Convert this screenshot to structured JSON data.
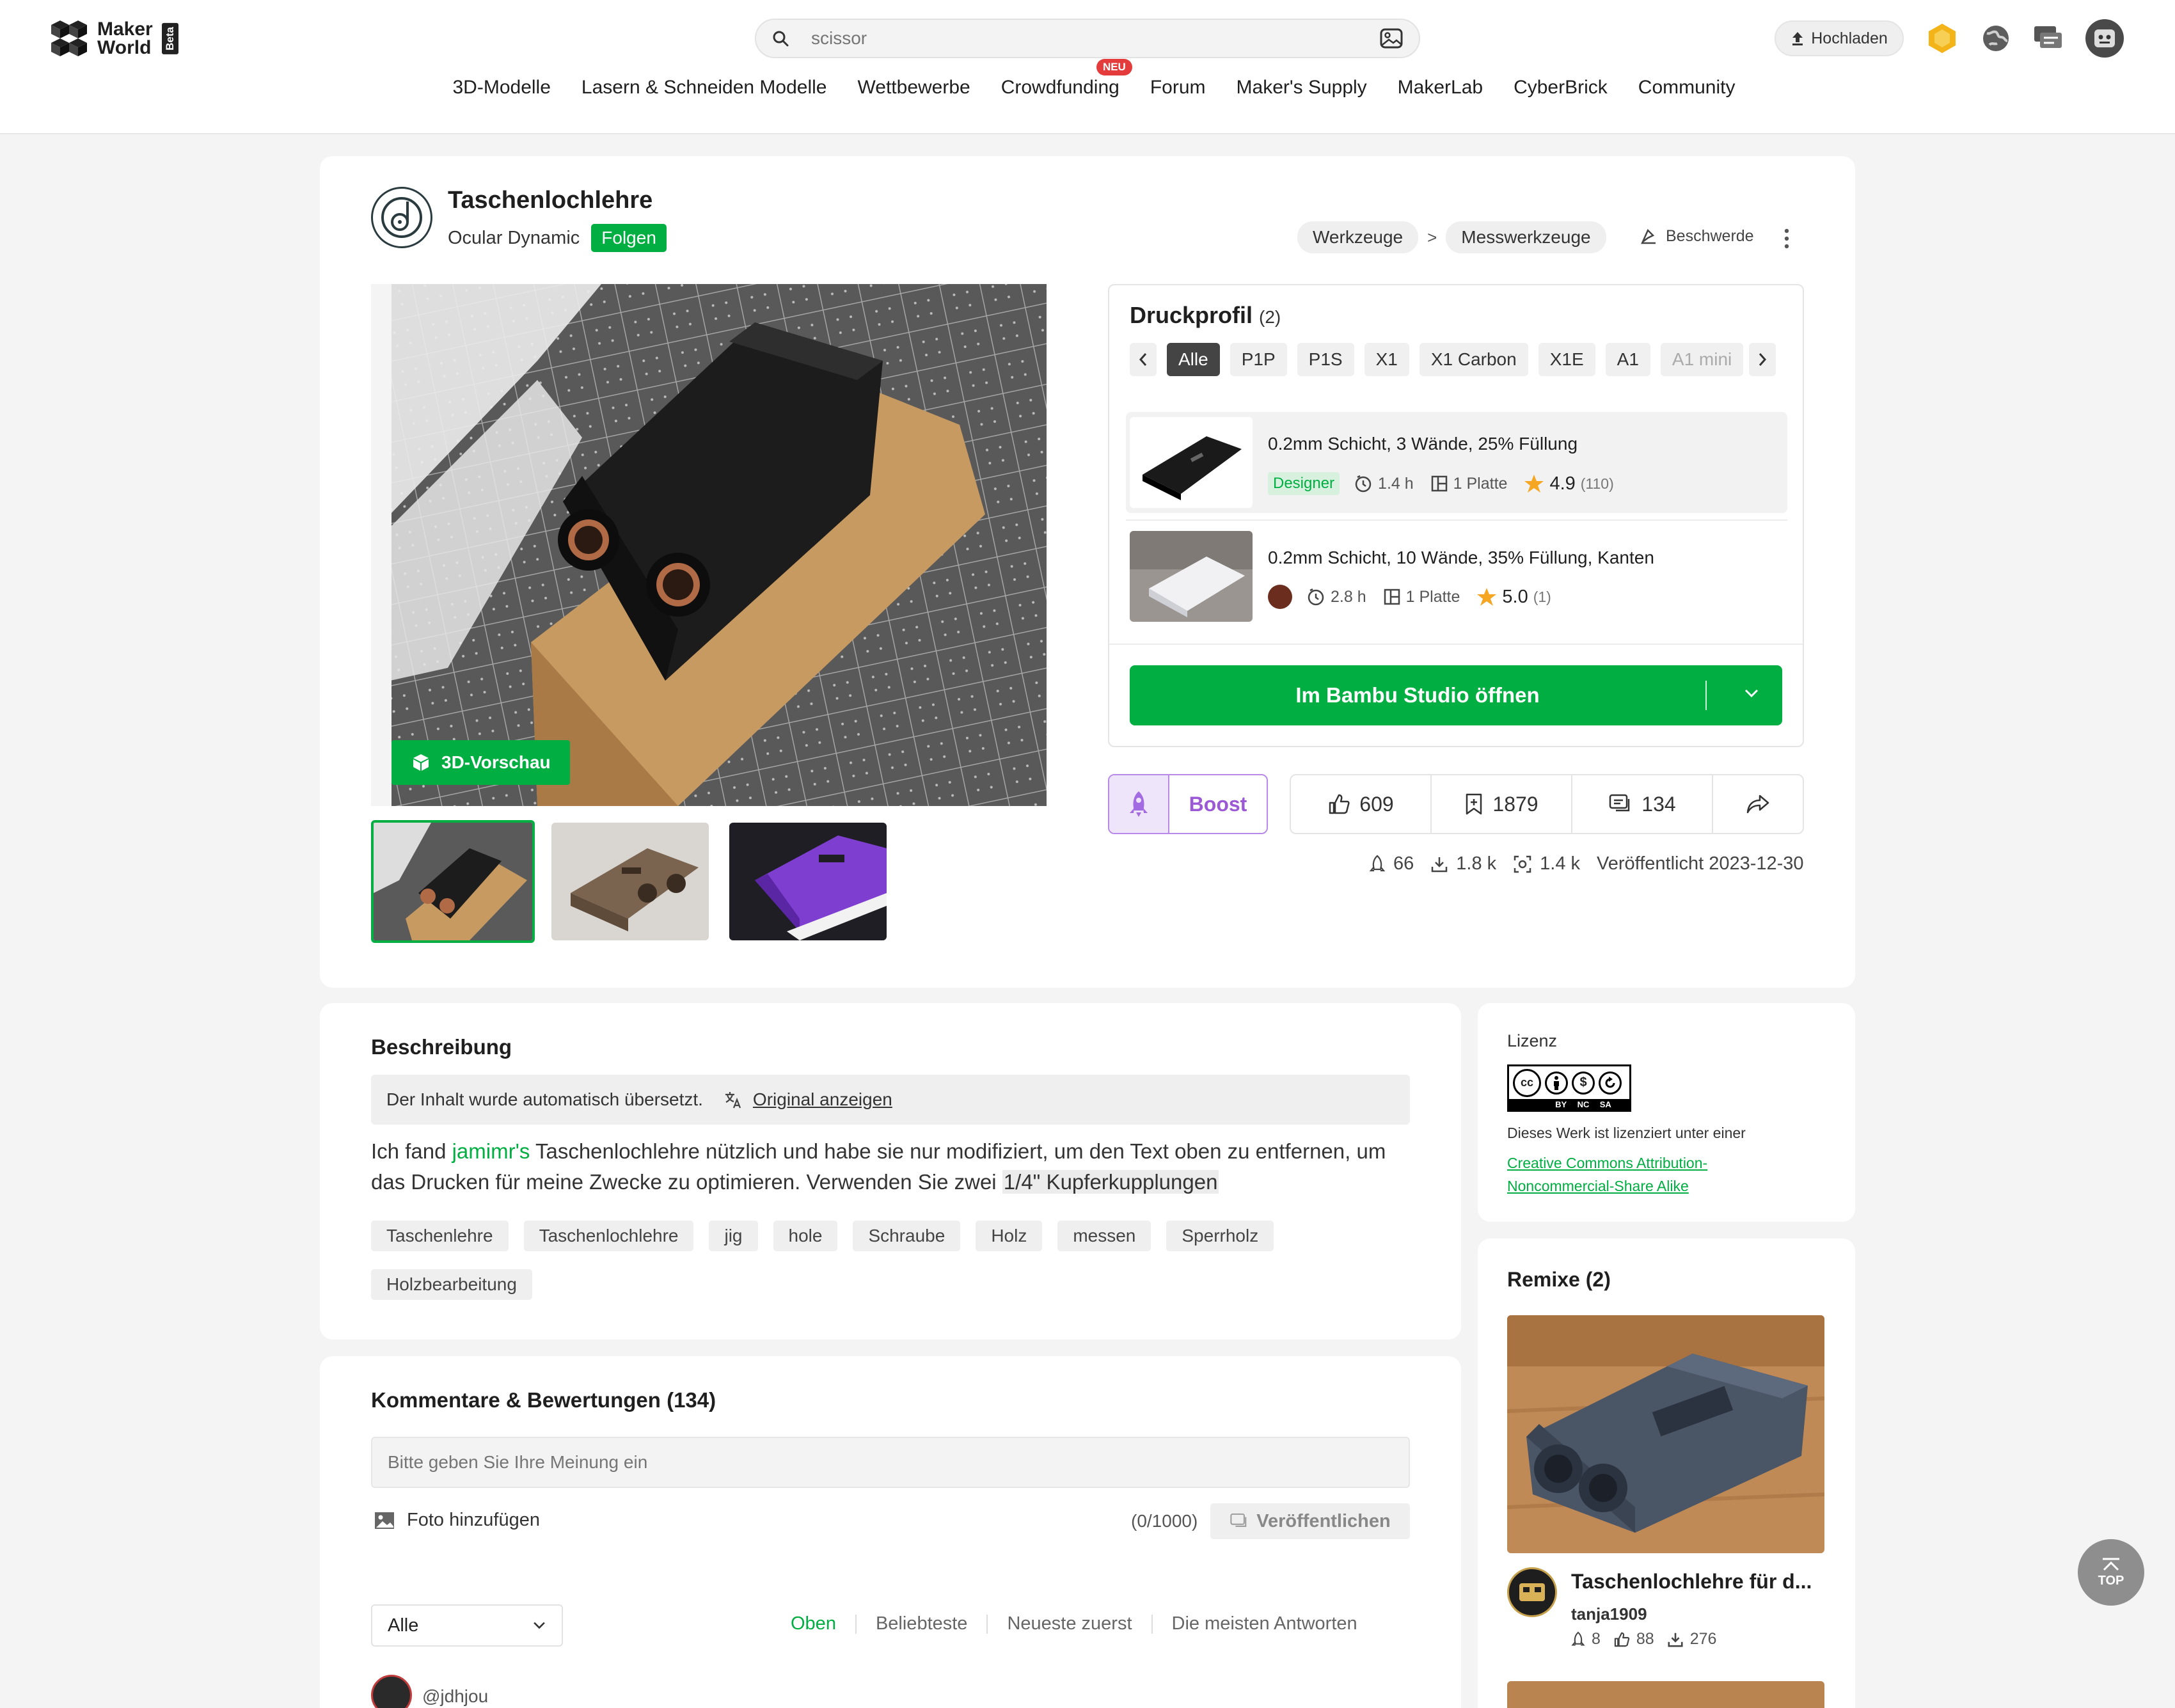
{
  "header": {
    "logo_line1": "Maker",
    "logo_line2": "World",
    "logo_badge": "Beta",
    "search_placeholder": "scissor",
    "upload_label": "Hochladen",
    "nav": [
      "3D-Modelle",
      "Lasern & Schneiden Modelle",
      "Wettbewerbe",
      "Crowdfunding",
      "Forum",
      "Maker's Supply",
      "MakerLab",
      "CyberBrick",
      "Community"
    ],
    "new_badge": "NEU"
  },
  "model": {
    "title": "Taschenlochlehre",
    "author": "Ocular Dynamic",
    "follow_label": "Folgen",
    "breadcrumb": [
      "Werkzeuge",
      "Messwerkzeuge"
    ],
    "breadcrumb_sep": ">",
    "report_label": "Beschwerde",
    "preview_label": "3D-Vorschau"
  },
  "print_profile": {
    "heading": "Druckprofil",
    "count": "(2)",
    "tabs": [
      "Alle",
      "P1P",
      "P1S",
      "X1",
      "X1 Carbon",
      "X1E",
      "A1",
      "A1 mini"
    ],
    "profiles": [
      {
        "name": "0.2mm Schicht, 3 Wände, 25% Füllung",
        "badge": "Designer",
        "time": "1.4 h",
        "plates": "1 Platte",
        "rating": "4.9",
        "rating_count": "(110)"
      },
      {
        "name": "0.2mm Schicht, 10 Wände, 35% Füllung, Kanten",
        "time": "2.8 h",
        "plates": "1 Platte",
        "rating": "5.0",
        "rating_count": "(1)"
      }
    ],
    "open_button": "Im Bambu Studio öffnen"
  },
  "actions": {
    "boost": "Boost",
    "likes": "609",
    "collects": "1879",
    "comments": "134"
  },
  "stats": {
    "boosts": "66",
    "downloads": "1.8 k",
    "prints": "1.4 k",
    "published": "Veröffentlicht 2023-12-30"
  },
  "description": {
    "heading": "Beschreibung",
    "translated_notice": "Der Inhalt wurde automatisch übersetzt.",
    "show_original": "Original anzeigen",
    "text_before": "Ich fand ",
    "link_user": "jamimr's",
    "text_middle": " Taschenlochlehre nützlich und habe sie nur modifiziert, um den Text oben zu entfernen, um das Drucken für meine Zwecke zu optimieren. Verwenden Sie zwei ",
    "highlight": "1/4\" Kupferkupplungen",
    "tags": [
      "Taschenlehre",
      "Taschenlochlehre",
      "jig",
      "hole",
      "Schraube",
      "Holz",
      "messen",
      "Sperrholz",
      "Holzbearbeitung"
    ]
  },
  "license": {
    "heading": "Lizenz",
    "badge_labels": [
      "BY",
      "NC",
      "SA"
    ],
    "text": "Dieses Werk ist lizenziert unter einer",
    "link_line1": "Creative Commons Attribution-",
    "link_line2": "Noncommercial-Share Alike"
  },
  "remix": {
    "heading": "Remixe (2)",
    "title": "Taschenlochlehre für d...",
    "user": "tanja1909",
    "boosts": "8",
    "likes": "88",
    "downloads": "276"
  },
  "comments": {
    "heading": "Kommentare & Bewertungen (134)",
    "input_placeholder": "Bitte geben Sie Ihre Meinung ein",
    "add_photo": "Foto hinzufügen",
    "char_count": "(0/1000)",
    "publish": "Veröffentlichen",
    "filter_value": "Alle",
    "sort_options": [
      "Oben",
      "Beliebteste",
      "Neueste zuerst",
      "Die meisten Antworten"
    ],
    "first_user": "@jdhjou"
  },
  "top_button": "TOP",
  "colors": {
    "brand_green": "#00ae42",
    "boost_purple": "#9b59d6",
    "star": "#f5a623"
  }
}
